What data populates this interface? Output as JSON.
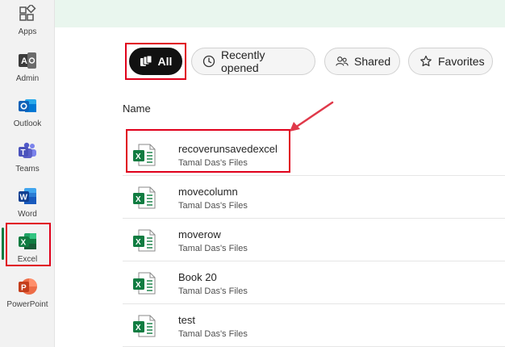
{
  "rail": {
    "items": [
      {
        "label": "Apps",
        "icon": "apps-icon"
      },
      {
        "label": "Admin",
        "icon": "admin-icon"
      },
      {
        "label": "Outlook",
        "icon": "outlook-icon"
      },
      {
        "label": "Teams",
        "icon": "teams-icon"
      },
      {
        "label": "Word",
        "icon": "word-icon"
      },
      {
        "label": "Excel",
        "icon": "excel-icon"
      },
      {
        "label": "PowerPoint",
        "icon": "powerpoint-icon"
      }
    ],
    "active": "Excel"
  },
  "filters": {
    "all": "All",
    "recent": "Recently opened",
    "shared": "Shared",
    "favorites": "Favorites"
  },
  "list": {
    "column_name": "Name",
    "files": [
      {
        "name": "recoverunsavedexcel",
        "location": "Tamal Das's Files"
      },
      {
        "name": "movecolumn",
        "location": "Tamal Das's Files"
      },
      {
        "name": "moverow",
        "location": "Tamal Das's Files"
      },
      {
        "name": "Book 20",
        "location": "Tamal Das's Files"
      },
      {
        "name": "test",
        "location": "Tamal Das's Files"
      }
    ]
  },
  "colors": {
    "excel_green": "#107c41",
    "annotation_red": "#e0001b",
    "banner": "#e9f6ee"
  }
}
